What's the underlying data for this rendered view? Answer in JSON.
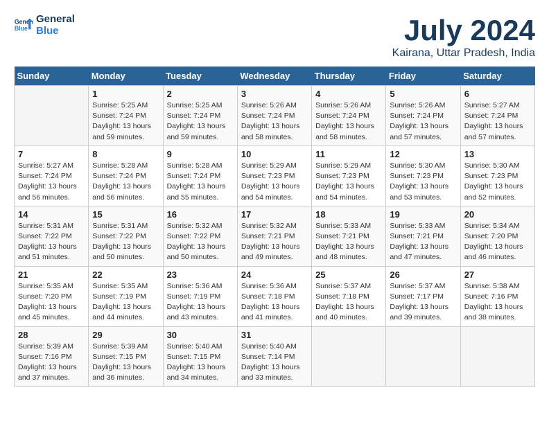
{
  "logo": {
    "line1": "General",
    "line2": "Blue"
  },
  "title": "July 2024",
  "subtitle": "Kairana, Uttar Pradesh, India",
  "days_header": [
    "Sunday",
    "Monday",
    "Tuesday",
    "Wednesday",
    "Thursday",
    "Friday",
    "Saturday"
  ],
  "weeks": [
    [
      {
        "num": "",
        "info": ""
      },
      {
        "num": "1",
        "info": "Sunrise: 5:25 AM\nSunset: 7:24 PM\nDaylight: 13 hours\nand 59 minutes."
      },
      {
        "num": "2",
        "info": "Sunrise: 5:25 AM\nSunset: 7:24 PM\nDaylight: 13 hours\nand 59 minutes."
      },
      {
        "num": "3",
        "info": "Sunrise: 5:26 AM\nSunset: 7:24 PM\nDaylight: 13 hours\nand 58 minutes."
      },
      {
        "num": "4",
        "info": "Sunrise: 5:26 AM\nSunset: 7:24 PM\nDaylight: 13 hours\nand 58 minutes."
      },
      {
        "num": "5",
        "info": "Sunrise: 5:26 AM\nSunset: 7:24 PM\nDaylight: 13 hours\nand 57 minutes."
      },
      {
        "num": "6",
        "info": "Sunrise: 5:27 AM\nSunset: 7:24 PM\nDaylight: 13 hours\nand 57 minutes."
      }
    ],
    [
      {
        "num": "7",
        "info": "Sunrise: 5:27 AM\nSunset: 7:24 PM\nDaylight: 13 hours\nand 56 minutes."
      },
      {
        "num": "8",
        "info": "Sunrise: 5:28 AM\nSunset: 7:24 PM\nDaylight: 13 hours\nand 56 minutes."
      },
      {
        "num": "9",
        "info": "Sunrise: 5:28 AM\nSunset: 7:24 PM\nDaylight: 13 hours\nand 55 minutes."
      },
      {
        "num": "10",
        "info": "Sunrise: 5:29 AM\nSunset: 7:23 PM\nDaylight: 13 hours\nand 54 minutes."
      },
      {
        "num": "11",
        "info": "Sunrise: 5:29 AM\nSunset: 7:23 PM\nDaylight: 13 hours\nand 54 minutes."
      },
      {
        "num": "12",
        "info": "Sunrise: 5:30 AM\nSunset: 7:23 PM\nDaylight: 13 hours\nand 53 minutes."
      },
      {
        "num": "13",
        "info": "Sunrise: 5:30 AM\nSunset: 7:23 PM\nDaylight: 13 hours\nand 52 minutes."
      }
    ],
    [
      {
        "num": "14",
        "info": "Sunrise: 5:31 AM\nSunset: 7:22 PM\nDaylight: 13 hours\nand 51 minutes."
      },
      {
        "num": "15",
        "info": "Sunrise: 5:31 AM\nSunset: 7:22 PM\nDaylight: 13 hours\nand 50 minutes."
      },
      {
        "num": "16",
        "info": "Sunrise: 5:32 AM\nSunset: 7:22 PM\nDaylight: 13 hours\nand 50 minutes."
      },
      {
        "num": "17",
        "info": "Sunrise: 5:32 AM\nSunset: 7:21 PM\nDaylight: 13 hours\nand 49 minutes."
      },
      {
        "num": "18",
        "info": "Sunrise: 5:33 AM\nSunset: 7:21 PM\nDaylight: 13 hours\nand 48 minutes."
      },
      {
        "num": "19",
        "info": "Sunrise: 5:33 AM\nSunset: 7:21 PM\nDaylight: 13 hours\nand 47 minutes."
      },
      {
        "num": "20",
        "info": "Sunrise: 5:34 AM\nSunset: 7:20 PM\nDaylight: 13 hours\nand 46 minutes."
      }
    ],
    [
      {
        "num": "21",
        "info": "Sunrise: 5:35 AM\nSunset: 7:20 PM\nDaylight: 13 hours\nand 45 minutes."
      },
      {
        "num": "22",
        "info": "Sunrise: 5:35 AM\nSunset: 7:19 PM\nDaylight: 13 hours\nand 44 minutes."
      },
      {
        "num": "23",
        "info": "Sunrise: 5:36 AM\nSunset: 7:19 PM\nDaylight: 13 hours\nand 43 minutes."
      },
      {
        "num": "24",
        "info": "Sunrise: 5:36 AM\nSunset: 7:18 PM\nDaylight: 13 hours\nand 41 minutes."
      },
      {
        "num": "25",
        "info": "Sunrise: 5:37 AM\nSunset: 7:18 PM\nDaylight: 13 hours\nand 40 minutes."
      },
      {
        "num": "26",
        "info": "Sunrise: 5:37 AM\nSunset: 7:17 PM\nDaylight: 13 hours\nand 39 minutes."
      },
      {
        "num": "27",
        "info": "Sunrise: 5:38 AM\nSunset: 7:16 PM\nDaylight: 13 hours\nand 38 minutes."
      }
    ],
    [
      {
        "num": "28",
        "info": "Sunrise: 5:39 AM\nSunset: 7:16 PM\nDaylight: 13 hours\nand 37 minutes."
      },
      {
        "num": "29",
        "info": "Sunrise: 5:39 AM\nSunset: 7:15 PM\nDaylight: 13 hours\nand 36 minutes."
      },
      {
        "num": "30",
        "info": "Sunrise: 5:40 AM\nSunset: 7:15 PM\nDaylight: 13 hours\nand 34 minutes."
      },
      {
        "num": "31",
        "info": "Sunrise: 5:40 AM\nSunset: 7:14 PM\nDaylight: 13 hours\nand 33 minutes."
      },
      {
        "num": "",
        "info": ""
      },
      {
        "num": "",
        "info": ""
      },
      {
        "num": "",
        "info": ""
      }
    ]
  ]
}
